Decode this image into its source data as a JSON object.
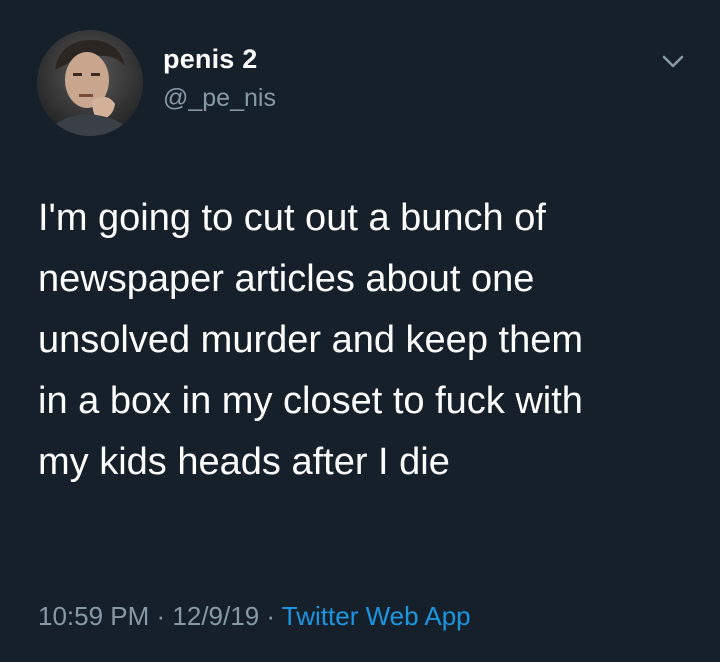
{
  "tweet": {
    "display_name": "penis 2",
    "handle": "@_pe_nis",
    "text": "I'm going to cut out a bunch of\nnewspaper articles about one\nunsolved murder and keep them\nin a box in my closet to fuck with\nmy kids heads after I die",
    "time": "10:59 PM",
    "separator": " · ",
    "date": "12/9/19",
    "source": "Twitter Web App"
  },
  "icons": {
    "avatar": "profile-photo",
    "menu": "chevron-down-icon"
  },
  "colors": {
    "background": "#15202b",
    "primary_text": "#ffffff",
    "secondary_text": "#8899a6",
    "link": "#1b95e0"
  }
}
